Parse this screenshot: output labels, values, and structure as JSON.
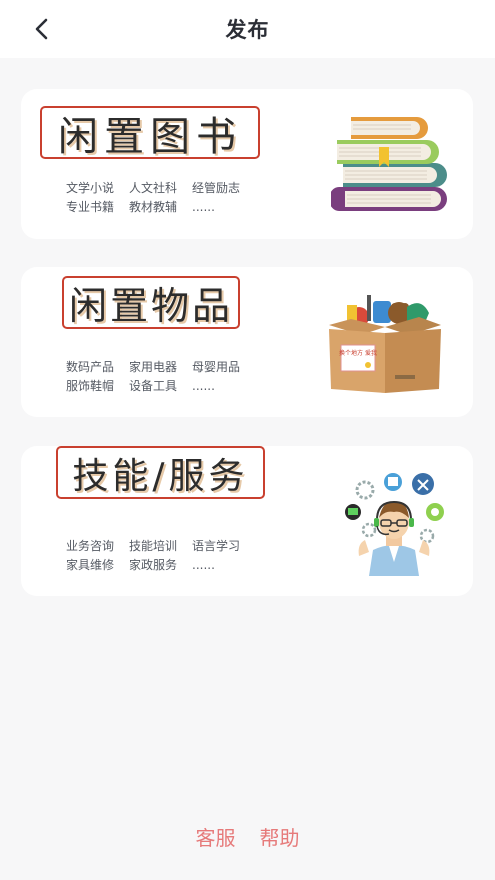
{
  "header": {
    "title": "发布"
  },
  "cards": [
    {
      "title": "闲置图书",
      "tags": [
        "文学小说",
        "人文社科",
        "经管励志",
        "专业书籍",
        "教材教辅",
        "......"
      ]
    },
    {
      "title": "闲置物品",
      "tags": [
        "数码产品",
        "家用电器",
        "母婴用品",
        "服饰鞋帽",
        "设备工具",
        "......"
      ]
    },
    {
      "title": "技能/服务",
      "tags": [
        "业务咨询",
        "技能培训",
        "语言学习",
        "家具维修",
        "家政服务",
        "......"
      ]
    }
  ],
  "box_label": "换个地方 爱我",
  "footer": {
    "service": "客服",
    "help": "帮助"
  },
  "colors": {
    "accent_red": "#c9402f",
    "footer_text": "#e67a7a",
    "background": "#f7f7f8"
  }
}
